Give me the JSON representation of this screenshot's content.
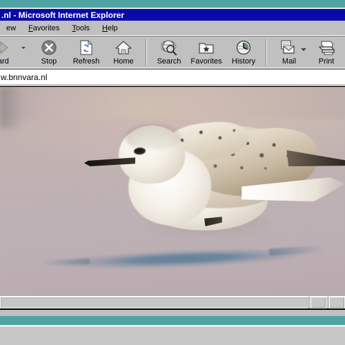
{
  "window": {
    "title": ".nl - Microsoft Internet Explorer",
    "title_color": "#0a0aa8"
  },
  "desktop": {
    "background_color": "#4fa3a3"
  },
  "menubar": {
    "items": [
      {
        "label": "ew",
        "accel": "",
        "name": "menu-view"
      },
      {
        "label": "Favorites",
        "accel": "a",
        "name": "menu-favorites"
      },
      {
        "label": "Tools",
        "accel": "T",
        "name": "menu-tools"
      },
      {
        "label": "Help",
        "accel": "H",
        "name": "menu-help"
      }
    ]
  },
  "toolbar": {
    "buttons": [
      {
        "label": "ward",
        "icon": "forward-arrow-icon",
        "name": "forward-button",
        "has_dropdown": true
      },
      {
        "label": "Stop",
        "icon": "stop-x-icon",
        "name": "stop-button",
        "has_dropdown": false
      },
      {
        "label": "Refresh",
        "icon": "refresh-page-icon",
        "name": "refresh-button",
        "has_dropdown": false
      },
      {
        "label": "Home",
        "icon": "home-house-icon",
        "name": "home-button",
        "has_dropdown": false
      },
      {
        "label": "Search",
        "icon": "search-globe-magnifier-icon",
        "name": "search-button",
        "has_dropdown": false
      },
      {
        "label": "Favorites",
        "icon": "favorites-folder-star-icon",
        "name": "favorites-button",
        "has_dropdown": false
      },
      {
        "label": "History",
        "icon": "history-clock-globe-icon",
        "name": "history-button",
        "has_dropdown": false
      },
      {
        "label": "Mail",
        "icon": "mail-envelope-icon",
        "name": "mail-button",
        "has_dropdown": true
      },
      {
        "label": "Print",
        "icon": "printer-icon",
        "name": "print-button",
        "has_dropdown": false
      }
    ]
  },
  "address_bar": {
    "value": "w.bnnvara.nl",
    "placeholder": "Address"
  },
  "content": {
    "description": "Photograph of a sanderling shorebird standing on wet sand with its shadow cast to the lower left",
    "subject": "sanderling-bird",
    "background_color": "#c2b3b2",
    "shadow_color": "#6d879f",
    "beak_color": "#1e1b17"
  },
  "scrollbar": {
    "orientation": "horizontal",
    "left_arrow": "◄",
    "right_arrow": "►"
  },
  "statusbar": {
    "text": ""
  }
}
